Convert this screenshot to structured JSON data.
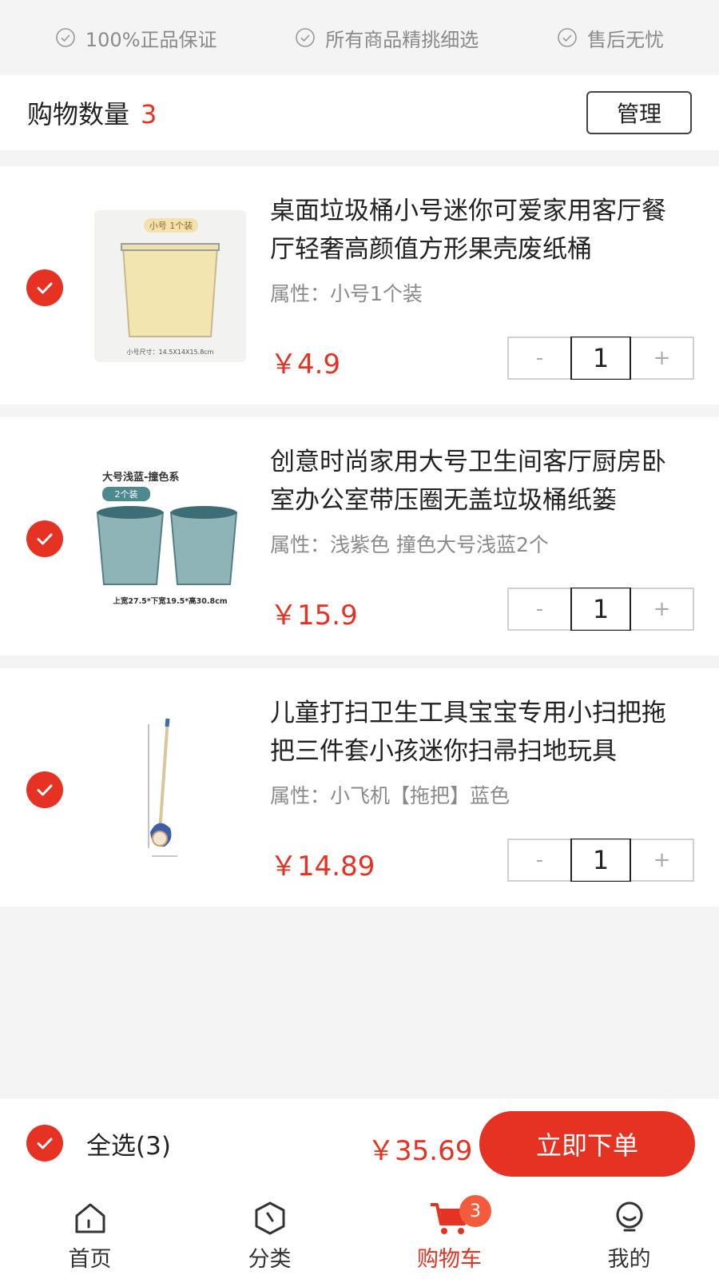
{
  "guarantees": [
    "100%正品保证",
    "所有商品精挑细选",
    "售后无忧"
  ],
  "header": {
    "title": "购物数量",
    "count": "3",
    "manage_label": "管理"
  },
  "items": [
    {
      "title": "桌面垃圾桶小号迷你可爱家用客厅餐厅轻奢高颜值方形果壳废纸桶",
      "attr": "属性：小号1个装",
      "price": "￥4.9",
      "qty": "1",
      "image_label": "小号 1个装",
      "image_caption": "小号尺寸：14.5X14X15.8cm",
      "checked": true
    },
    {
      "title": "创意时尚家用大号卫生间客厅厨房卧室办公室带压圈无盖垃圾桶纸篓",
      "attr": "属性：浅紫色 撞色大号浅蓝2个",
      "price": "￥15.9",
      "qty": "1",
      "image_label": "大号浅蓝-撞色系",
      "image_tag": "2个装",
      "image_caption": "上宽27.5*下宽19.5*高30.8cm",
      "checked": true
    },
    {
      "title": "儿童打扫卫生工具宝宝专用小扫把拖把三件套小孩迷你扫帚扫地玩具",
      "attr": "属性：小飞机【拖把】蓝色",
      "price": "￥14.89",
      "qty": "1",
      "checked": true
    }
  ],
  "stepper": {
    "minus": "-",
    "plus": "+"
  },
  "footer": {
    "select_all": "全选(3)",
    "total": "￥35.69",
    "order_label": "立即下单"
  },
  "tabs": [
    {
      "label": "首页",
      "icon": "home-icon"
    },
    {
      "label": "分类",
      "icon": "category-icon"
    },
    {
      "label": "购物车",
      "icon": "cart-icon",
      "badge": "3",
      "active": true
    },
    {
      "label": "我的",
      "icon": "profile-icon"
    }
  ],
  "colors": {
    "accent": "#e53223",
    "muted": "#8a8a8a",
    "background": "#f4f4f4"
  }
}
